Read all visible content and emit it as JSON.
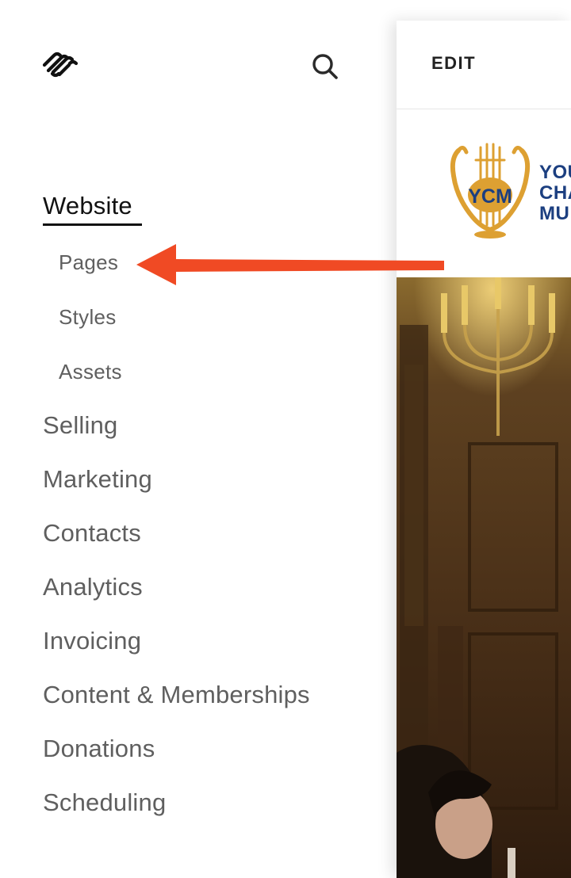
{
  "sidebar": {
    "nav": {
      "website": "Website",
      "sub": {
        "pages": "Pages",
        "styles": "Styles",
        "assets": "Assets"
      },
      "selling": "Selling",
      "marketing": "Marketing",
      "contacts": "Contacts",
      "analytics": "Analytics",
      "invoicing": "Invoicing",
      "content_memberships": "Content & Memberships",
      "donations": "Donations",
      "scheduling": "Scheduling"
    }
  },
  "preview": {
    "edit_label": "EDIT",
    "site_logo_text": "YCM",
    "brand_lines": [
      "YOU",
      "CHA",
      "MU"
    ]
  },
  "colors": {
    "callout_arrow": "#f04a24",
    "logo_gold": "#dda032",
    "brand_blue": "#1c3f80"
  }
}
